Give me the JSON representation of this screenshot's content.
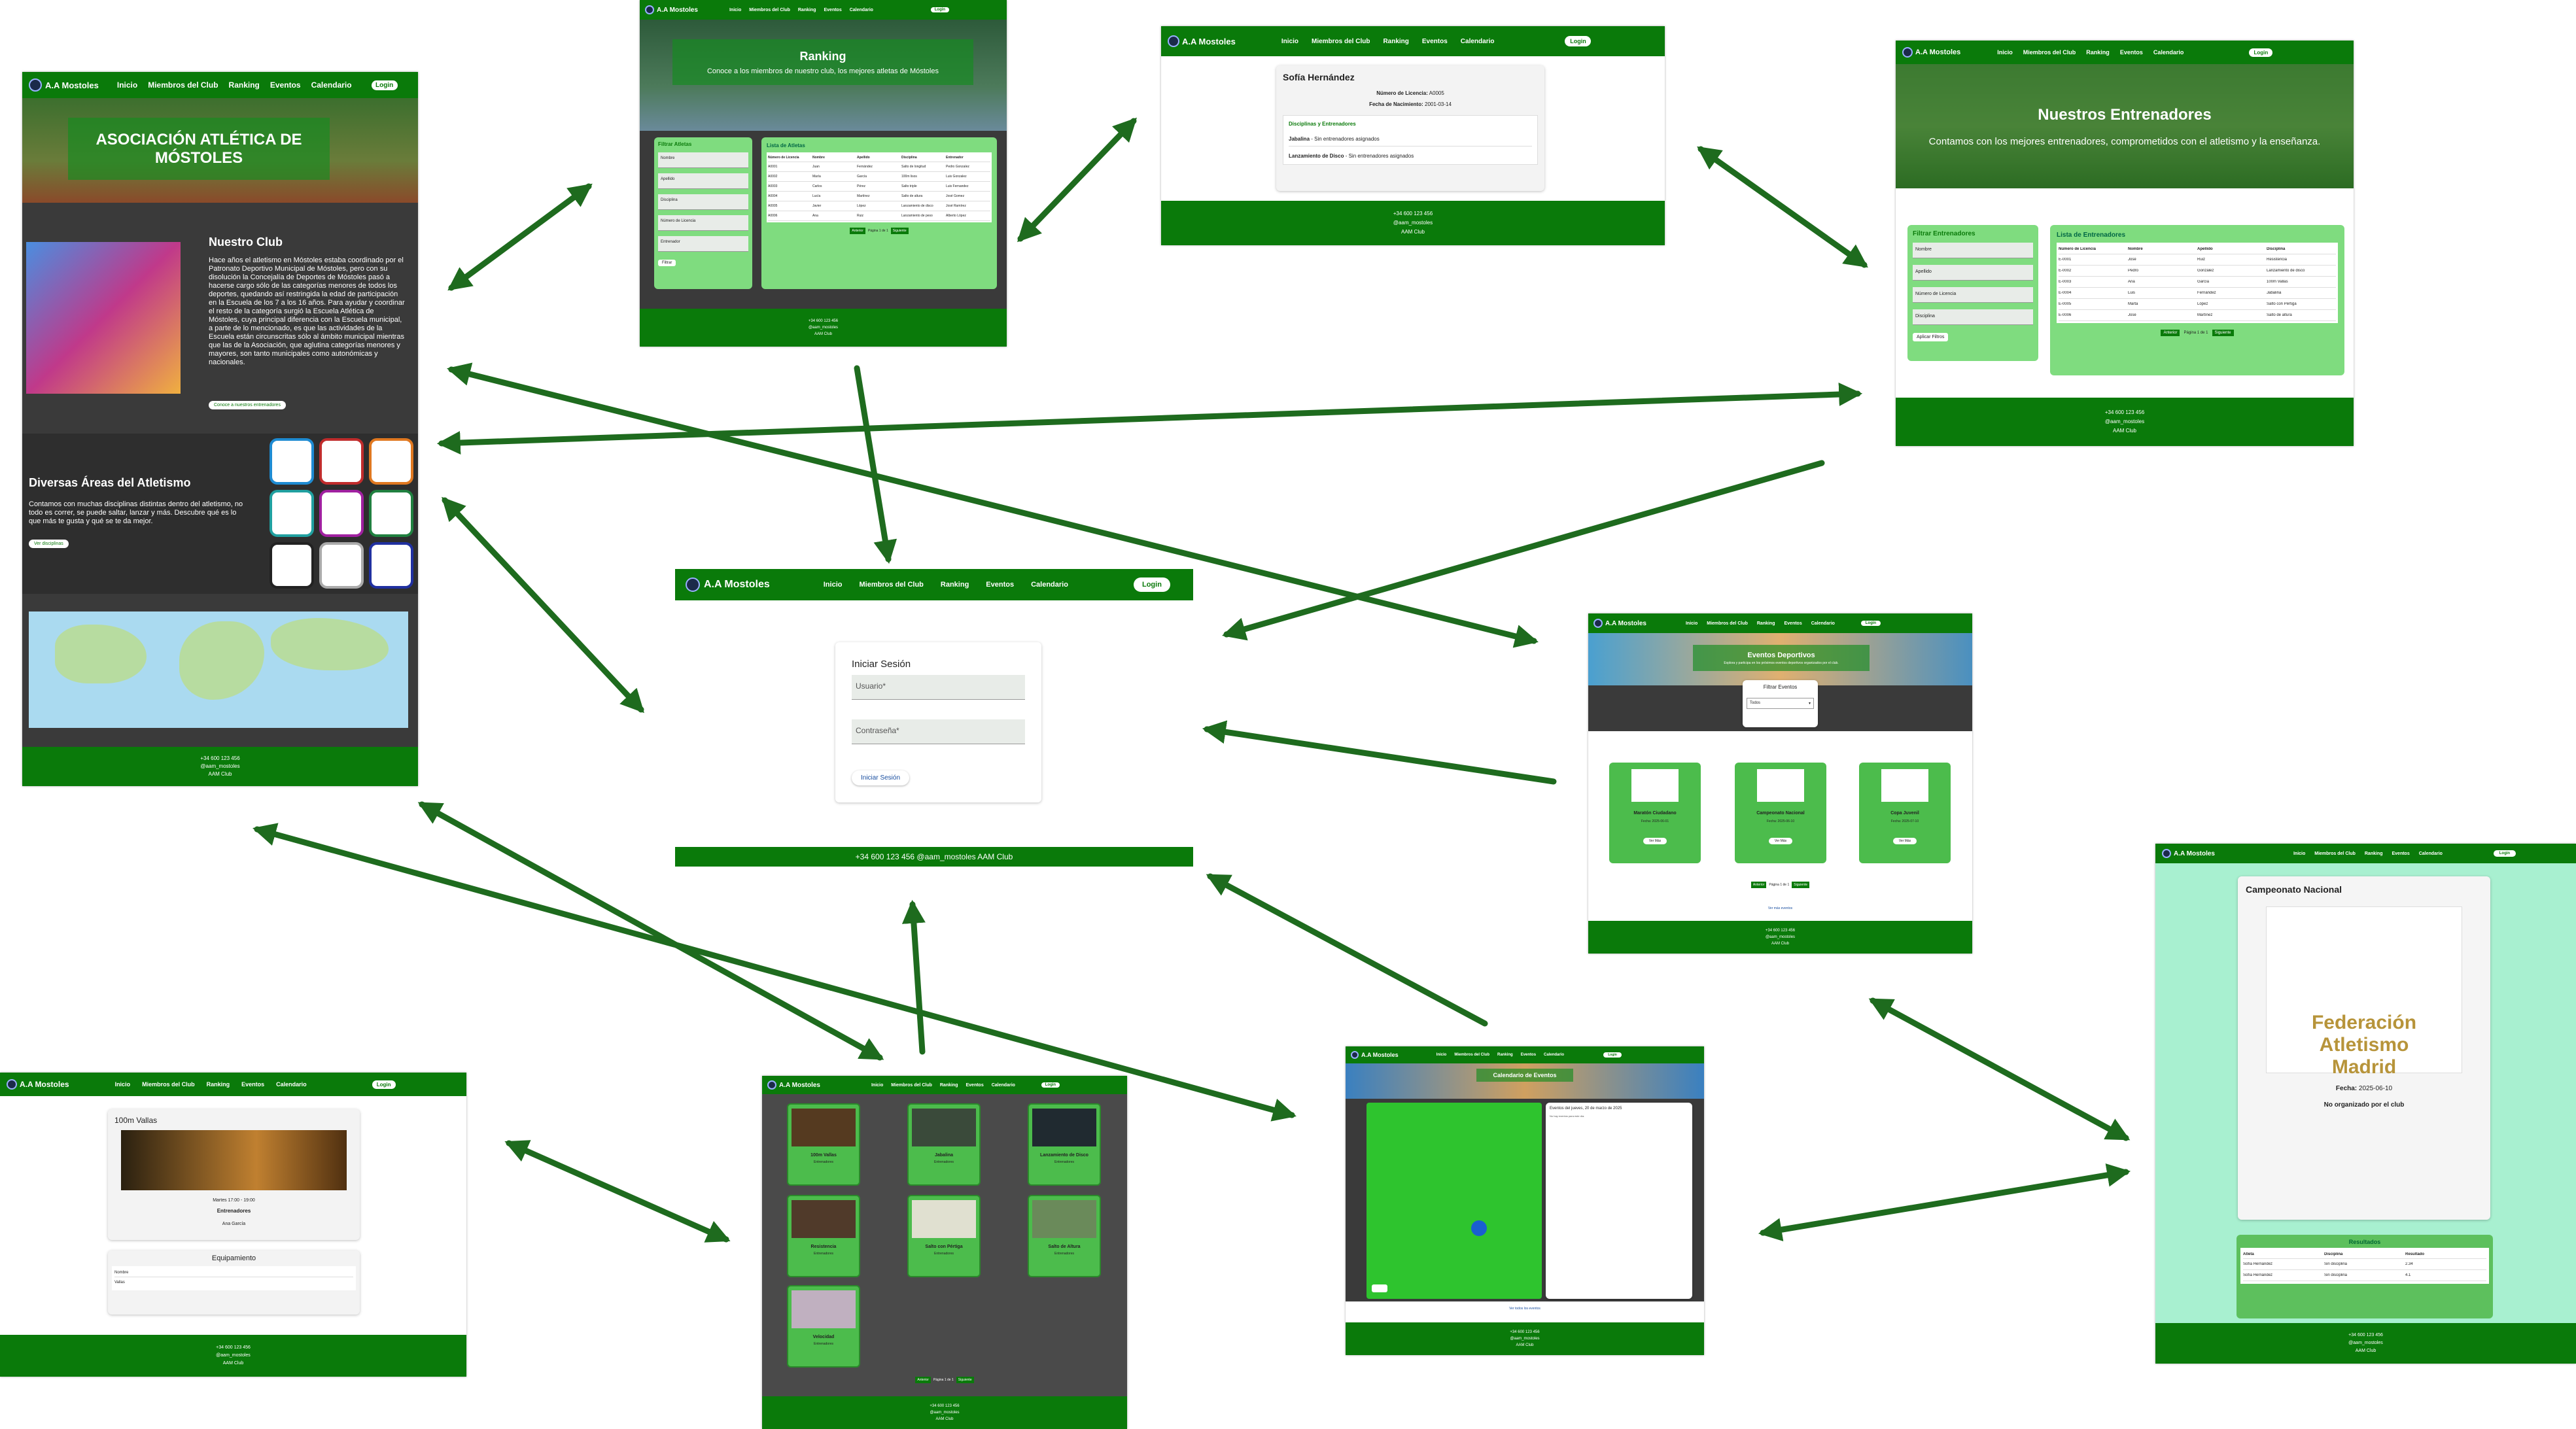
{
  "nav": {
    "brand": "A.A Mostoles",
    "links": [
      "Inicio",
      "Miembros del Club",
      "Ranking",
      "Eventos",
      "Calendario"
    ],
    "login": "Login"
  },
  "footer": {
    "phone": "+34 600 123 456",
    "handle": "@aam_mostoles",
    "club": "AAM Club",
    "inline": "+34 600 123 456 @aam_mostoles AAM Club"
  },
  "home": {
    "hero_title": "ASOCIACIÓN ATLÉTICA DE MÓSTOLES",
    "club_title": "Nuestro Club",
    "club_text": "Hace años el atletismo en Móstoles estaba coordinado por el Patronato Deportivo Municipal de Móstoles, pero con su disolución la Concejalía de Deportes de Móstoles pasó a hacerse cargo sólo de las categorías menores de todos los deportes, quedando así restringida la edad de participación en la Escuela de los 7 a los 16 años. Para ayudar y coordinar el resto de la categoría surgió la Escuela Atlética de Móstoles, cuya principal diferencia con la Escuela municipal, a parte de lo mencionado, es que las actividades de la Escuela están circunscritas sólo al ámbito municipal mientras que las de la Asociación, que aglutina categorías menores y mayores, son tanto municipales como autonómicas y nacionales.",
    "club_button": "Conoce a nuestros entrenadores",
    "areas_title": "Diversas Áreas del Atletismo",
    "areas_text": "Contamos con muchas disciplinas distintas dentro del atletismo, no todo es correr, se puede saltar, lanzar y más. Descubre qué es lo que más te gusta y qué se te da mejor.",
    "areas_button": "Ver disciplinas"
  },
  "ranking": {
    "title": "Ranking",
    "subtitle": "Conoce a los miembros de nuestro club, los mejores atletas de Móstoles",
    "filter_title": "Filtrar Atletas",
    "filters": [
      "Nombre",
      "Apellido",
      "Disciplina",
      "Número de Licencia",
      "Entrenador"
    ],
    "filter_button": "Filtrar",
    "list_title": "Lista de Atletas",
    "columns": [
      "Número de Licencia",
      "Nombre",
      "Apellido",
      "Disciplina",
      "Entrenador"
    ],
    "rows": [
      [
        "A0001",
        "Juan",
        "Fernández",
        "Salto de longitud",
        "Pedro Gonzalez"
      ],
      [
        "A0002",
        "María",
        "García",
        "100m lisos",
        "Luis Gonzalez"
      ],
      [
        "A0003",
        "Carlos",
        "Pérez",
        "Salto triple",
        "Luis Fernandez"
      ],
      [
        "A0004",
        "Lucía",
        "Martínez",
        "Salto de altura",
        "José Gomez"
      ],
      [
        "A0005",
        "Javier",
        "López",
        "Lanzamiento de disco",
        "José Ramírez"
      ],
      [
        "A0006",
        "Ana",
        "Ruiz",
        "Lanzamiento de peso",
        "Alberto López"
      ]
    ],
    "prev": "Anterior",
    "page": "Página 1 de 1",
    "next": "Siguiente"
  },
  "athlete": {
    "name": "Sofía Hernández",
    "license_label": "Número de Licencia:",
    "license": "A0005",
    "birth_label": "Fecha de Nacimiento:",
    "birth": "2001-03-14",
    "disc_title": "Disciplinas y Entrenadores",
    "disciplines": [
      {
        "name": "Jabalina",
        "coach": " - Sin entrenadores asignados"
      },
      {
        "name": "Lanzamiento de Disco",
        "coach": " - Sin entrenadores asignados"
      }
    ]
  },
  "coaches": {
    "title": "Nuestros Entrenadores",
    "subtitle": "Contamos con los mejores entrenadores, comprometidos con el atletismo y la enseñanza.",
    "filter_title": "Filtrar Entrenadores",
    "filters": [
      "Nombre",
      "Apellido",
      "Número de Licencia",
      "Disciplina"
    ],
    "filter_button": "Aplicar Filtros",
    "list_title": "Lista de Entrenadores",
    "columns": [
      "Número de Licencia",
      "Nombre",
      "Apellido",
      "Disciplina"
    ],
    "rows": [
      [
        "E-0001",
        "José",
        "Ruiz",
        "Resistencia"
      ],
      [
        "E-0002",
        "Pedro",
        "González",
        "Lanzamiento de disco"
      ],
      [
        "E-0003",
        "Ana",
        "García",
        "100m Vallas"
      ],
      [
        "E-0004",
        "Luis",
        "Fernández",
        "Jabalina"
      ],
      [
        "E-0005",
        "Marta",
        "López",
        "Salto con Pértiga"
      ],
      [
        "E-0006",
        "José",
        "Martínez",
        "Salto de altura"
      ]
    ]
  },
  "login": {
    "title": "Iniciar Sesión",
    "user": "Usuario*",
    "password": "Contraseña*",
    "button": "Iniciar Sesión"
  },
  "events": {
    "title": "Eventos Deportivos",
    "subtitle": "Explora y participa en los próximos eventos deportivos organizados por el club.",
    "filter_title": "Filtrar Eventos",
    "filter_select": "Todos",
    "cards": [
      {
        "name": "Maratón Ciudadano",
        "date": "Fecha: 2025-06-01"
      },
      {
        "name": "Campeonato Nacional",
        "date": "Fecha: 2025-06-10"
      },
      {
        "name": "Copa Juvenil",
        "date": "Fecha: 2025-07-10"
      }
    ],
    "card_button": "Ver Más",
    "all_link": "Ver más eventos"
  },
  "event_detail": {
    "title": "Campeonato Nacional",
    "logo_line1": "Federación Atletismo",
    "logo_line2": "Madrid",
    "date_label": "Fecha:",
    "date": "2025-06-10",
    "organizer": "No organizado por el club",
    "results_title": "Resultados",
    "columns": [
      "Atleta",
      "Disciplina",
      "Resultado"
    ],
    "rows": [
      [
        "Sofía Hernández",
        "Sin disciplina",
        "2.34"
      ],
      [
        "Sofía Hernández",
        "Sin disciplina",
        "4.1"
      ]
    ]
  },
  "discipline": {
    "title": "100m Vallas",
    "schedule": "Martes 17:00 - 19:00",
    "coaches_label": "Entrenadores",
    "coach": "Ana García",
    "equipment_title": "Equipamiento",
    "equipment_col": "Nombre",
    "equipment_item": "Vallas"
  },
  "disciplines": {
    "cards": [
      "100m Vallas",
      "Jabalina",
      "Lanzamiento de Disco",
      "Resistencia",
      "Salto con Pértiga",
      "Salto de Altura",
      "Velocidad"
    ],
    "cards_sub": "Entrenadores"
  },
  "calendar": {
    "title": "Calendario de Eventos",
    "day_title": "Eventos del jueves, 20 de marzo de 2025",
    "day_text": "No hay eventos para este día.",
    "link": "Ver todos los eventos"
  }
}
